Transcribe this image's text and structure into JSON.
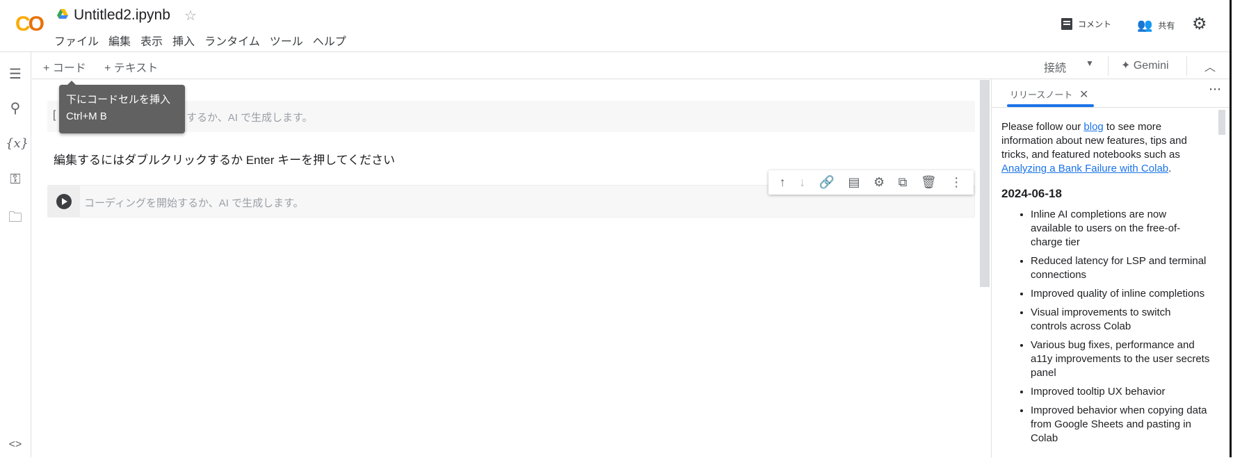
{
  "header": {
    "logo": "CO",
    "title": "Untitled2.ipynb",
    "menu": [
      "ファイル",
      "編集",
      "表示",
      "挿入",
      "ランタイム",
      "ツール",
      "ヘルプ"
    ],
    "comment": "コメント",
    "share": "共有"
  },
  "toolbar": {
    "add_code": "+ コード",
    "add_text": "+ テキスト",
    "connect": "接続",
    "gemini": "Gemini"
  },
  "tooltip": {
    "title": "下にコードセルを挿入",
    "shortcut": "Ctrl+M B"
  },
  "cells": {
    "first_placeholder": "するか、AI で生成します。",
    "first_bracket": "[",
    "text_cell": "編集するにはダブルクリックするか Enter キーを押してください",
    "code_placeholder": "コーディングを開始するか、AI で生成します。"
  },
  "panel": {
    "tab": "リリースノート",
    "intro_1": "Please follow our ",
    "blog": "blog",
    "intro_2": " to see more information about new features, tips and tricks, and featured notebooks such as ",
    "featured": "Analyzing a Bank Failure with Colab",
    "intro_3": ".",
    "date": "2024-06-18",
    "items": [
      "Inline AI completions are now available to users on the free-of-charge tier",
      "Reduced latency for LSP and terminal connections",
      "Improved quality of inline completions",
      "Visual improvements to switch controls across Colab",
      "Various bug fixes, performance and a11y improvements to the user secrets panel",
      "Improved tooltip UX behavior",
      "Improved behavior when copying data from Google Sheets and pasting in Colab"
    ]
  },
  "colors": {
    "accent": "#1a73e8",
    "logo_yellow": "#f9ab00",
    "logo_orange": "#e8710a",
    "tooltip": "#616161"
  }
}
